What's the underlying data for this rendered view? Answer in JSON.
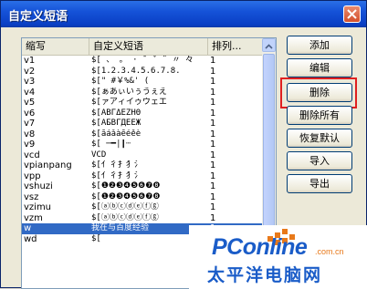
{
  "window": {
    "title": "自定义短语"
  },
  "columns": {
    "abbr": "缩写",
    "phrase": "自定义短语",
    "order": "排列..."
  },
  "rows": [
    {
      "abbr": "v1",
      "phrase": "$[ 、 。 · ˉ ˇ ¨ 〃 々",
      "order": "1"
    },
    {
      "abbr": "v2",
      "phrase": "$[1.2.3.4.5.6.7.8.",
      "order": "1"
    },
    {
      "abbr": "v3",
      "phrase": "$[\" #￥%&' ( ",
      "order": "1"
    },
    {
      "abbr": "v4",
      "phrase": "$[ぁあぃいぅうぇえ",
      "order": "1"
    },
    {
      "abbr": "v5",
      "phrase": "$[ァアィイゥウェエ",
      "order": "1"
    },
    {
      "abbr": "v6",
      "phrase": "$[ΑΒΓΔΕΖΗΘ",
      "order": "1"
    },
    {
      "abbr": "v7",
      "phrase": "$[АБВГДЕЁЖ",
      "order": "1"
    },
    {
      "abbr": "v8",
      "phrase": "$[āáǎàēéěè",
      "order": "1"
    },
    {
      "abbr": "v9",
      "phrase": "$[ ─━│┃┄",
      "order": "1"
    },
    {
      "abbr": "vcd",
      "phrase": "VCD",
      "order": "1"
    },
    {
      "abbr": "vpianpang",
      "phrase": "$[亻彳扌犭氵",
      "order": "1"
    },
    {
      "abbr": "vpp",
      "phrase": "$[亻彳扌犭氵",
      "order": "1"
    },
    {
      "abbr": "vshuzi",
      "phrase": "$[❶❷❸❹❺❻❼❽",
      "order": "1"
    },
    {
      "abbr": "vsz",
      "phrase": "$[❶❷❸❹❺❻❼❽",
      "order": "1"
    },
    {
      "abbr": "vzimu",
      "phrase": "$[ⓐⓑⓒⓓⓔⓕⓖ",
      "order": "1"
    },
    {
      "abbr": "vzm",
      "phrase": "$[ⓐⓑⓒⓓⓔⓕⓖ",
      "order": "1"
    },
    {
      "abbr": "w",
      "phrase": "我在与百度经验",
      "order": "1"
    },
    {
      "abbr": "wd",
      "phrase": "$[",
      "order": ""
    }
  ],
  "buttons": {
    "add": "添加",
    "edit": "编辑",
    "delete": "删除",
    "delete_all": "删除所有",
    "restore": "恢复默认",
    "import": "导入",
    "export": "导出"
  },
  "watermark": {
    "brand": "PConline",
    "domain": ".com.cn",
    "cn": "太平洋电脑网"
  },
  "colors": {
    "selection": "#316ac5",
    "highlight": "#e02020",
    "title_bar": "#0a3fc4"
  }
}
